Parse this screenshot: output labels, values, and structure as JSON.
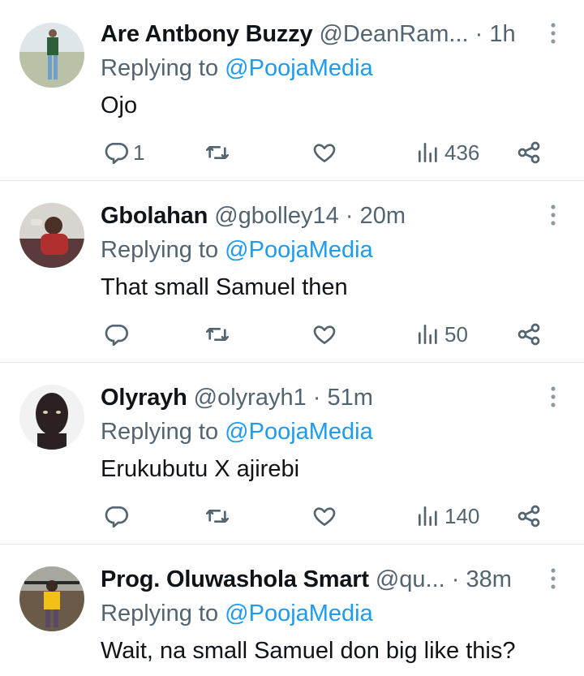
{
  "tweets": [
    {
      "name": "Are Antbony Buzzy",
      "handle": "@DeanRam...",
      "sep": "·",
      "time": "1h",
      "reply_prefix": "Replying to",
      "reply_to": "@PoojaMedia",
      "text": "Ojo",
      "replies": "1",
      "retweets": "",
      "likes": "",
      "views": "436"
    },
    {
      "name": "Gbolahan",
      "handle": "@gbolley14",
      "sep": "·",
      "time": "20m",
      "reply_prefix": "Replying to",
      "reply_to": "@PoojaMedia",
      "text": "That small Samuel then",
      "replies": "",
      "retweets": "",
      "likes": "",
      "views": "50"
    },
    {
      "name": "Olyrayh",
      "handle": "@olyrayh1",
      "sep": "·",
      "time": "51m",
      "reply_prefix": "Replying to",
      "reply_to": "@PoojaMedia",
      "text": "Erukubutu X ajirebi",
      "replies": "",
      "retweets": "",
      "likes": "",
      "views": "140"
    },
    {
      "name": "Prog. Oluwashola Smart",
      "handle": "@qu...",
      "sep": "·",
      "time": "38m",
      "reply_prefix": "Replying to",
      "reply_to": "@PoojaMedia",
      "text": "Wait, na small Samuel don big like this?",
      "replies": "",
      "retweets": "",
      "likes": "",
      "views": ""
    }
  ],
  "colors": {
    "text": "#0f1419",
    "muted": "#536471",
    "link": "#1d9bf0",
    "divider": "#e6e9ec"
  },
  "icons": {
    "reply": "reply-icon",
    "retweet": "retweet-icon",
    "like": "heart-icon",
    "views": "views-icon",
    "share": "share-icon",
    "more": "more-vertical-icon"
  }
}
